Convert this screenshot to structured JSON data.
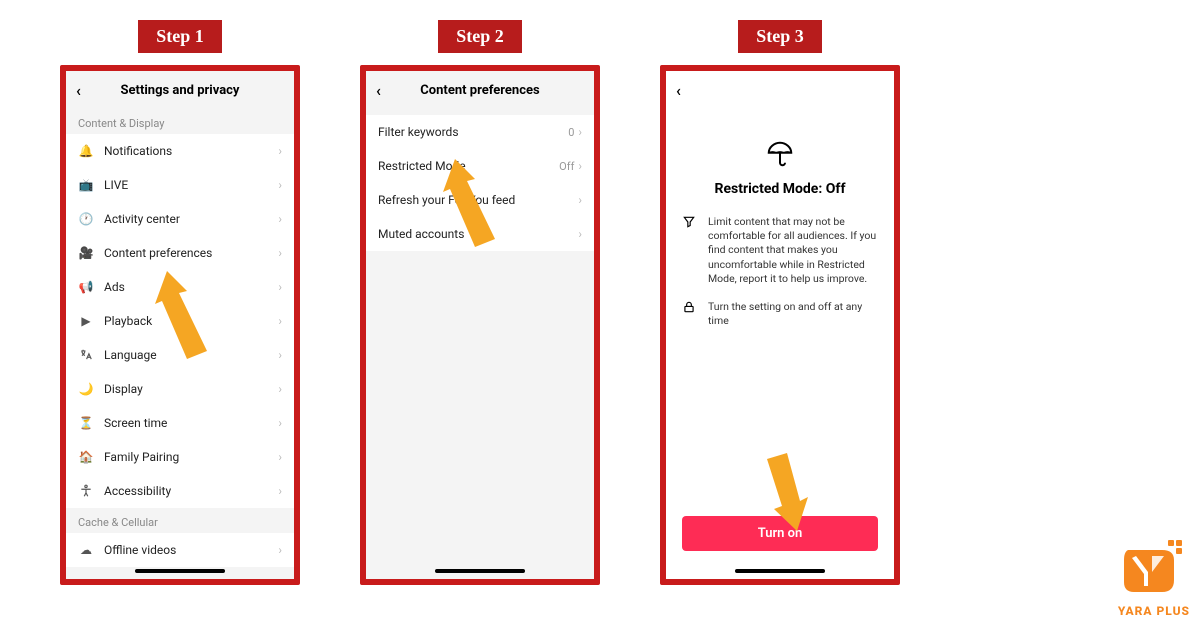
{
  "steps": {
    "s1": {
      "label": "Step 1"
    },
    "s2": {
      "label": "Step 2"
    },
    "s3": {
      "label": "Step 3"
    }
  },
  "screen1": {
    "title": "Settings and privacy",
    "section1": "Content & Display",
    "items": [
      {
        "label": "Notifications"
      },
      {
        "label": "LIVE"
      },
      {
        "label": "Activity center"
      },
      {
        "label": "Content preferences"
      },
      {
        "label": "Ads"
      },
      {
        "label": "Playback"
      },
      {
        "label": "Language"
      },
      {
        "label": "Display"
      },
      {
        "label": "Screen time"
      },
      {
        "label": "Family Pairing"
      },
      {
        "label": "Accessibility"
      }
    ],
    "section2": "Cache & Cellular",
    "items2": [
      {
        "label": "Offline videos"
      }
    ]
  },
  "screen2": {
    "title": "Content preferences",
    "items": [
      {
        "label": "Filter keywords",
        "value": "0"
      },
      {
        "label": "Restricted Mode",
        "value": "Off"
      },
      {
        "label": "Refresh your For You feed",
        "value": ""
      },
      {
        "label": "Muted accounts",
        "value": ""
      }
    ]
  },
  "screen3": {
    "title": "Restricted Mode: Off",
    "info1": "Limit content that may not be comfortable for all audiences. If you find content that makes you uncomfortable while in Restricted Mode, report it to help us improve.",
    "info2": "Turn the setting on and off at any time",
    "button": "Turn on"
  },
  "logo": {
    "text": "YARA PLUS"
  }
}
